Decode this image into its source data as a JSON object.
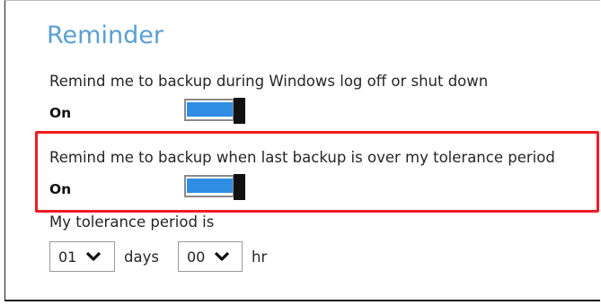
{
  "reminder": {
    "title": "Reminder",
    "option1": {
      "label": "Remind me to backup during Windows log off or shut down",
      "state": "On"
    },
    "option2": {
      "label": "Remind me to backup when last backup is over my tolerance period",
      "state": "On"
    },
    "tolerance": {
      "label": "My tolerance period is",
      "days": {
        "value": "01",
        "unit": "days"
      },
      "hours": {
        "value": "00",
        "unit": "hr"
      }
    }
  },
  "icons": {
    "dropdown": "chevron-down-icon"
  },
  "colors": {
    "title": "#5a9fd4",
    "toggle_fill": "#2f8de4",
    "highlight": "#ee1c24"
  }
}
